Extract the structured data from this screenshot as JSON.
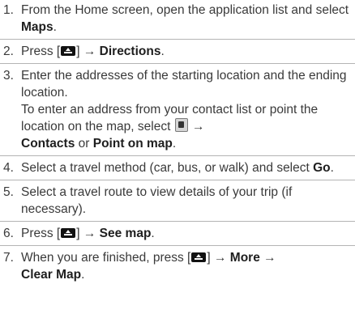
{
  "steps": [
    {
      "num": "1.",
      "t1": "From the Home screen, open the application list and select ",
      "b1": "Maps",
      "t2": "."
    },
    {
      "num": "2.",
      "t1": "Press [",
      "key_icon": "menu-key-icon",
      "t2": "] → ",
      "b1": "Directions",
      "t3": "."
    },
    {
      "num": "3.",
      "t1": "Enter the addresses of the starting location and the ending location.",
      "t2": "To enter an address from your contact list or point the location on the map, select ",
      "icon": "contacts-icon",
      "t3": " → ",
      "b1": "Contacts",
      "t4": " or ",
      "b2": "Point on map",
      "t5": "."
    },
    {
      "num": "4.",
      "t1": "Select a travel method (car, bus, or walk) and select ",
      "b1": "Go",
      "t2": "."
    },
    {
      "num": "5.",
      "t1": "Select a travel route to view details of your trip (if necessary)."
    },
    {
      "num": "6.",
      "t1": "Press [",
      "key_icon": "menu-key-icon",
      "t2": "] → ",
      "b1": "See map",
      "t3": "."
    },
    {
      "num": "7.",
      "t1": "When you are finished, press [",
      "key_icon": "menu-key-icon",
      "t2": "] → ",
      "b1": "More",
      "t3": " → ",
      "b2": "Clear Map",
      "t4": "."
    }
  ],
  "colors": {
    "text": "#3a3a3a",
    "bold_text": "#1e1e1e",
    "divider": "#b4b4b4",
    "key_bg": "#111111"
  }
}
